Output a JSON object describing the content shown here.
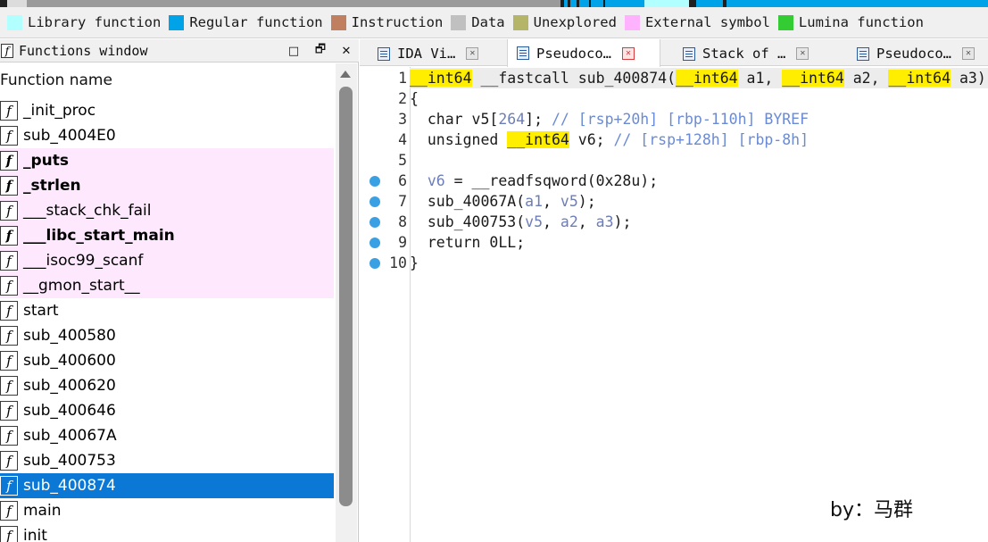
{
  "legend": {
    "items": [
      {
        "label": "Library function",
        "color": "#b2ffff"
      },
      {
        "label": "Regular function",
        "color": "#00a2e8"
      },
      {
        "label": "Instruction",
        "color": "#c08060"
      },
      {
        "label": "Data",
        "color": "#c0c0c0"
      },
      {
        "label": "Unexplored",
        "color": "#b5b56a"
      },
      {
        "label": "External symbol",
        "color": "#ffb3ff"
      },
      {
        "label": "Lumina function",
        "color": "#33cc33"
      }
    ]
  },
  "functions_window": {
    "title": "Functions window",
    "column_header": "Function name",
    "icon_glyph": "f",
    "controls": {
      "float": "□",
      "restore": "🗗",
      "close": "✕"
    },
    "items": [
      {
        "name": "_init_proc",
        "type": "regular",
        "bold": false,
        "selected": false
      },
      {
        "name": "sub_4004E0",
        "type": "regular",
        "bold": false,
        "selected": false
      },
      {
        "name": "_puts",
        "type": "external",
        "bold": true,
        "selected": false
      },
      {
        "name": "_strlen",
        "type": "external",
        "bold": true,
        "selected": false
      },
      {
        "name": "___stack_chk_fail",
        "type": "external",
        "bold": false,
        "selected": false
      },
      {
        "name": "___libc_start_main",
        "type": "external",
        "bold": true,
        "selected": false
      },
      {
        "name": "___isoc99_scanf",
        "type": "external",
        "bold": false,
        "selected": false
      },
      {
        "name": "__gmon_start__",
        "type": "external",
        "bold": false,
        "selected": false
      },
      {
        "name": "start",
        "type": "regular",
        "bold": false,
        "selected": false
      },
      {
        "name": "sub_400580",
        "type": "regular",
        "bold": false,
        "selected": false
      },
      {
        "name": "sub_400600",
        "type": "regular",
        "bold": false,
        "selected": false
      },
      {
        "name": "sub_400620",
        "type": "regular",
        "bold": false,
        "selected": false
      },
      {
        "name": "sub_400646",
        "type": "regular",
        "bold": false,
        "selected": false
      },
      {
        "name": "sub_40067A",
        "type": "regular",
        "bold": false,
        "selected": false
      },
      {
        "name": "sub_400753",
        "type": "regular",
        "bold": false,
        "selected": false
      },
      {
        "name": "sub_400874",
        "type": "regular",
        "bold": false,
        "selected": true
      },
      {
        "name": "main",
        "type": "regular",
        "bold": false,
        "selected": false
      },
      {
        "name": "init",
        "type": "regular",
        "bold": false,
        "selected": false
      }
    ]
  },
  "tabs": [
    {
      "label": "IDA Vi…",
      "active": false
    },
    {
      "label": "Pseudoco…",
      "active": true
    },
    {
      "label": "Stack of …",
      "active": false
    },
    {
      "label": "Pseudoco…",
      "active": false
    }
  ],
  "code": {
    "lines": [
      {
        "num": "1",
        "dot": false,
        "tokens": [
          {
            "t": "__int64",
            "c": "hl"
          },
          {
            "t": " __fastcall sub_400874(",
            "c": "plain"
          },
          {
            "t": "__int64",
            "c": "hl"
          },
          {
            "t": " a1, ",
            "c": "plain"
          },
          {
            "t": "__int64",
            "c": "hl"
          },
          {
            "t": " a2, ",
            "c": "plain"
          },
          {
            "t": "__int64",
            "c": "hl"
          },
          {
            "t": " a3)",
            "c": "plain"
          }
        ]
      },
      {
        "num": "2",
        "dot": false,
        "tokens": [
          {
            "t": "{",
            "c": "plain"
          }
        ]
      },
      {
        "num": "3",
        "dot": false,
        "tokens": [
          {
            "t": "  char v5[",
            "c": "plain"
          },
          {
            "t": "264",
            "c": "var"
          },
          {
            "t": "]; ",
            "c": "plain"
          },
          {
            "t": "// [rsp+20h] [rbp-110h] BYREF",
            "c": "cmt"
          }
        ]
      },
      {
        "num": "4",
        "dot": false,
        "tokens": [
          {
            "t": "  unsigned ",
            "c": "plain"
          },
          {
            "t": "__int64",
            "c": "hl"
          },
          {
            "t": " v6; ",
            "c": "plain"
          },
          {
            "t": "// [rsp+128h] [rbp-8h]",
            "c": "cmt"
          }
        ]
      },
      {
        "num": "5",
        "dot": false,
        "tokens": []
      },
      {
        "num": "6",
        "dot": true,
        "tokens": [
          {
            "t": "  ",
            "c": "plain"
          },
          {
            "t": "v6",
            "c": "var"
          },
          {
            "t": " = __readfsqword(0x28u);",
            "c": "plain"
          }
        ]
      },
      {
        "num": "7",
        "dot": true,
        "tokens": [
          {
            "t": "  sub_40067A(",
            "c": "plain"
          },
          {
            "t": "a1",
            "c": "var"
          },
          {
            "t": ", ",
            "c": "plain"
          },
          {
            "t": "v5",
            "c": "var"
          },
          {
            "t": ");",
            "c": "plain"
          }
        ]
      },
      {
        "num": "8",
        "dot": true,
        "tokens": [
          {
            "t": "  sub_400753(",
            "c": "plain"
          },
          {
            "t": "v5",
            "c": "var"
          },
          {
            "t": ", ",
            "c": "plain"
          },
          {
            "t": "a2",
            "c": "var"
          },
          {
            "t": ", ",
            "c": "plain"
          },
          {
            "t": "a3",
            "c": "var"
          },
          {
            "t": ");",
            "c": "plain"
          }
        ]
      },
      {
        "num": "9",
        "dot": true,
        "tokens": [
          {
            "t": "  return 0LL;",
            "c": "plain"
          }
        ]
      },
      {
        "num": "10",
        "dot": true,
        "tokens": [
          {
            "t": "}",
            "c": "plain"
          }
        ]
      }
    ]
  },
  "watermark": "by：马群",
  "colors": {
    "selection": "#0a78d4",
    "external_row": "#fde8fd",
    "highlight": "#ffee00",
    "breakpoint_dot": "#3aa0e4"
  }
}
